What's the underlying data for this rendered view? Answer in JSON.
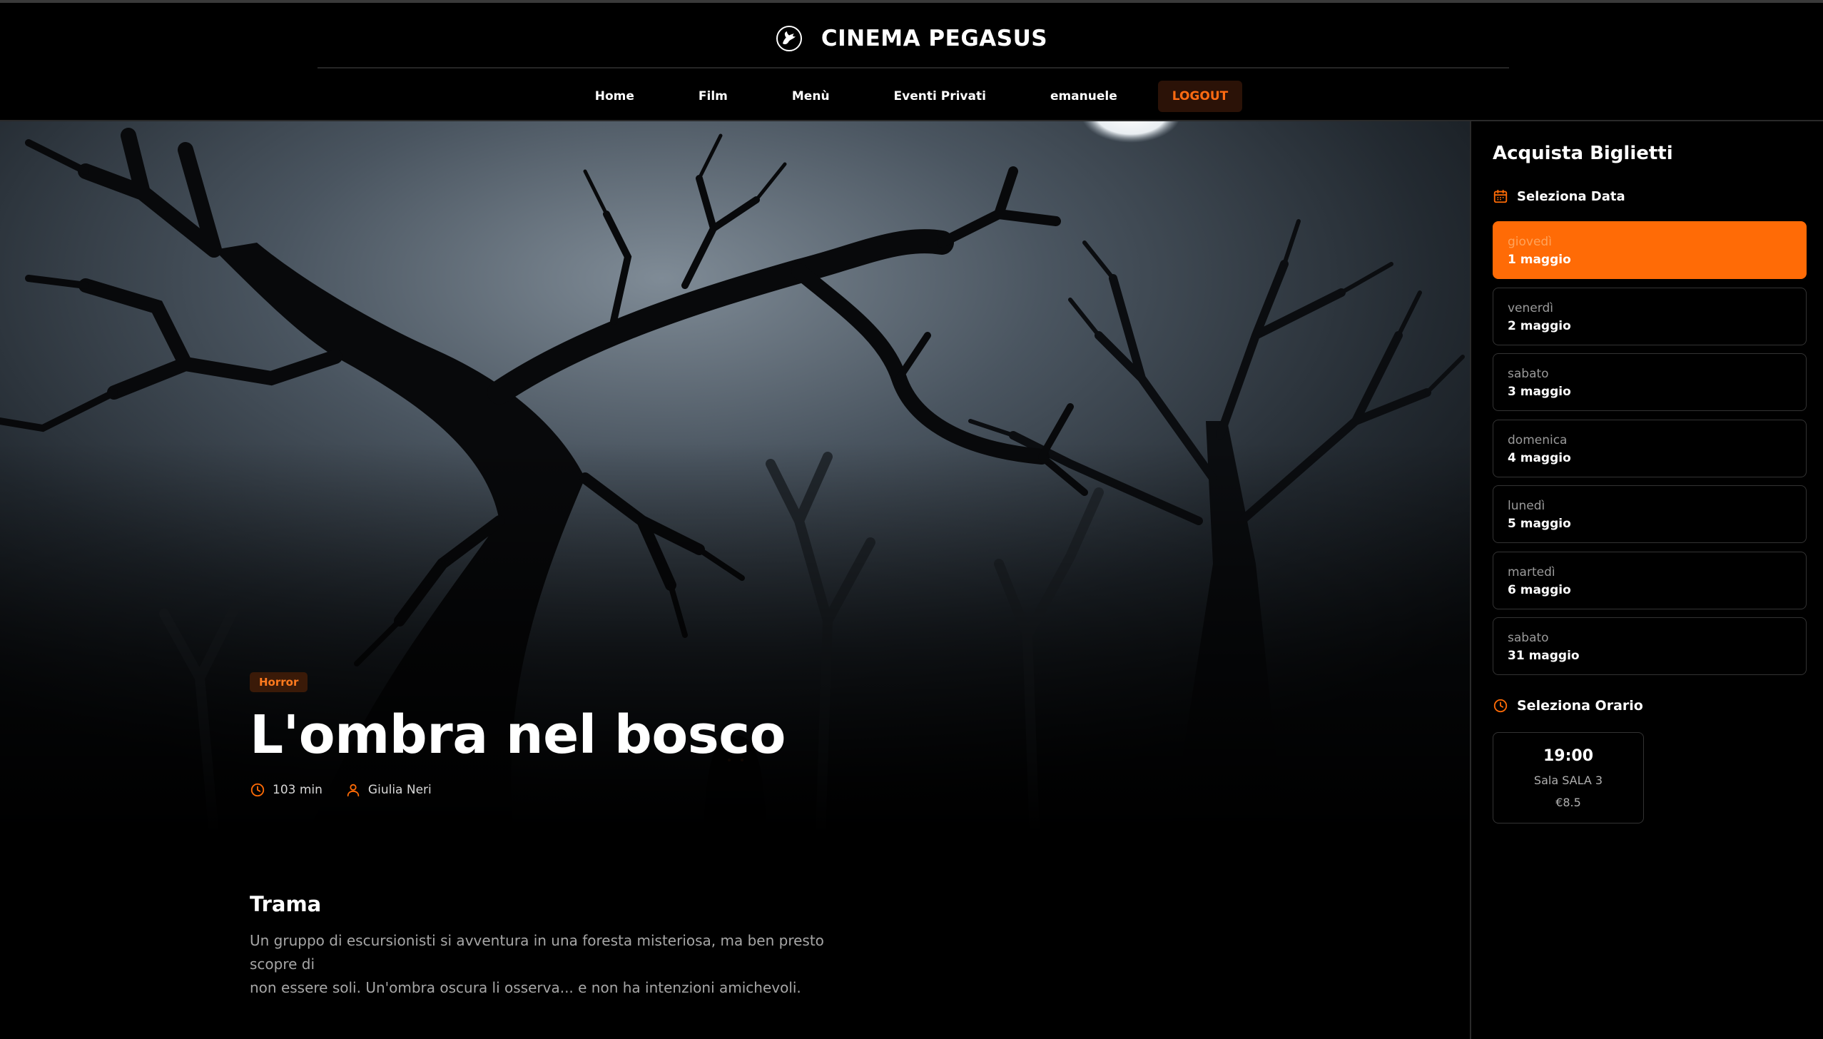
{
  "brand": {
    "name": "CINEMA PEGASUS",
    "logo_icon": "pegasus-logo-icon"
  },
  "nav": {
    "items": [
      "Home",
      "Film",
      "Menù",
      "Eventi Privati",
      "emanuele"
    ],
    "logout_label": "LOGOUT"
  },
  "movie": {
    "genre": "Horror",
    "title": "L'ombra nel bosco",
    "duration": "103 min",
    "director": "Giulia Neri",
    "duration_icon": "clock-icon",
    "director_icon": "user-icon",
    "plot_heading": "Trama",
    "plot_line1": "Un gruppo di escursionisti si avventura in una foresta misteriosa, ma ben presto scopre di",
    "plot_line2": "non essere soli. Un'ombra oscura li osserva... e non ha intenzioni amichevoli."
  },
  "sidebar": {
    "title": "Acquista Biglietti",
    "date_section": "Seleziona Data",
    "date_icon": "calendar-icon",
    "dates": [
      {
        "day": "giovedì",
        "date": "1 maggio",
        "selected": true
      },
      {
        "day": "venerdì",
        "date": "2 maggio",
        "selected": false
      },
      {
        "day": "sabato",
        "date": "3 maggio",
        "selected": false
      },
      {
        "day": "domenica",
        "date": "4 maggio",
        "selected": false
      },
      {
        "day": "lunedì",
        "date": "5 maggio",
        "selected": false
      },
      {
        "day": "martedì",
        "date": "6 maggio",
        "selected": false
      },
      {
        "day": "sabato",
        "date": "31 maggio",
        "selected": false
      }
    ],
    "time_section": "Seleziona Orario",
    "time_icon": "clock-icon",
    "showtimes": [
      {
        "time": "19:00",
        "room": "Sala SALA 3",
        "price": "€8.5"
      }
    ]
  },
  "colors": {
    "accent": "#ff6b06",
    "background": "#000000",
    "border": "#333333"
  }
}
